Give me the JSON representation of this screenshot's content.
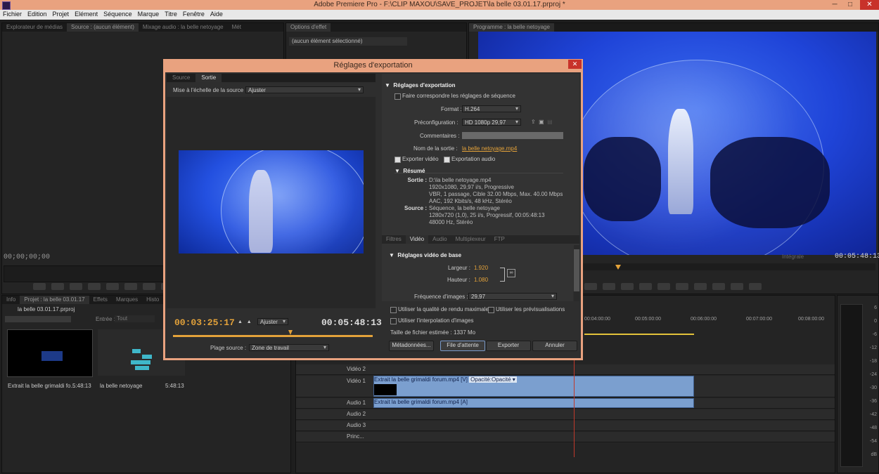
{
  "window": {
    "title": "Adobe Premiere Pro - F:\\CLIP MAXOU\\SAVE_PROJET\\la belle 03.01.17.prproj *",
    "minimize": "─",
    "maximize": "□",
    "close": "✕"
  },
  "menu": [
    "Fichier",
    "Edition",
    "Projet",
    "Elément",
    "Séquence",
    "Marque",
    "Titre",
    "Fenêtre",
    "Aide"
  ],
  "source_panel": {
    "tabs": [
      "Explorateur de médias",
      "Source : (aucun élément)",
      "Mixage audio : la belle netoyage",
      "Mét"
    ],
    "timecode": "00;00;00;00"
  },
  "effects_panel": {
    "tab": "Options d'effet",
    "placeholder": "(aucun élément sélectionné)"
  },
  "program_panel": {
    "tab": "Programme : la belle netoyage",
    "zoom": "Intégrale",
    "timecode": "00:05:48:13"
  },
  "project_panel": {
    "tabs": [
      "Info",
      "Projet : la belle 03.01.17",
      "Effets",
      "Marques",
      "Histo"
    ],
    "project_name": "la belle 03.01.17.prproj",
    "entry_label": "Entrée :",
    "entry_value": "Tout",
    "items": [
      {
        "name": "Extrait la belle grimaldi fo...",
        "duration": "5:48:13"
      },
      {
        "name": "la belle netoyage",
        "duration": "5:48:13"
      }
    ]
  },
  "timeline": {
    "ruler": [
      "00:04:00:00",
      "00:05:00:00",
      "00:06:00:00",
      "00:07:00:00",
      "00:08:00:00"
    ],
    "tracks": [
      {
        "name": "Vidéo 2"
      },
      {
        "name": "Vidéo 1",
        "clip": "Extrait la belle grimaldi forum.mp4 [V]",
        "fx": "Opacité:Opacité ▾"
      },
      {
        "name": "Audio 1",
        "clip": "Extrait la belle grimaldi forum.mp4 [A]"
      },
      {
        "name": "Audio 2"
      },
      {
        "name": "Audio 3"
      },
      {
        "name": "Princ..."
      }
    ]
  },
  "meter": {
    "labels": [
      "6",
      "0",
      "-6",
      "-12",
      "-18",
      "-24",
      "-30",
      "-36",
      "-42",
      "-48",
      "-54",
      "dB"
    ]
  },
  "dialog": {
    "title": "Réglages d'exportation",
    "close": "✕",
    "left_tabs": [
      "Source",
      "Sortie"
    ],
    "scale_label": "Mise à l'échelle de la source :",
    "scale_value": "Ajuster",
    "current_tc": "00:03:25:17",
    "fit_value": "Ajuster",
    "end_tc": "00:05:48:13",
    "range_label": "Plage source :",
    "range_value": "Zone de travail",
    "section_title": "Réglages d'exportation",
    "match_seq": "Faire correspondre les réglages de séquence",
    "format_label": "Format :",
    "format_value": "H.264",
    "preset_label": "Préconfiguration :",
    "preset_value": "HD 1080p 29,97",
    "comments_label": "Commentaires :",
    "output_label": "Nom de la sortie :",
    "output_value": "la belle netoyage.mp4",
    "export_video": "Exporter vidéo",
    "export_audio": "Exportation audio",
    "summary_title": "Résumé",
    "summary_output_label": "Sortie :",
    "summary_output": [
      "D:\\la belle netoyage.mp4",
      "1920x1080, 29,97 i/s, Progressive",
      "VBR, 1 passage, Cible 32.00 Mbps, Max. 40.00 Mbps",
      "AAC, 192  Kbits/s, 48  kHz, Stéréo"
    ],
    "summary_source_label": "Source :",
    "summary_source": [
      "Séquence, la belle netoyage",
      "1280x720 (1,0), 25  i/s, Progressif, 00:05:48:13",
      "48000 Hz, Stéréo"
    ],
    "right_tabs": [
      "Filtres",
      "Vidéo",
      "Audio",
      "Multiplexeur",
      "FTP"
    ],
    "basic_video": "Réglages vidéo de base",
    "width_label": "Largeur :",
    "width_value": "1.920",
    "height_label": "Hauteur :",
    "height_value": "1.080",
    "fps_label": "Fréquence d'images :",
    "fps_value": "29,97",
    "max_quality": "Utiliser la qualité de rendu maximale",
    "previews": "Utiliser les prévisualisations",
    "interp": "Utiliser l'interpolation d'images",
    "filesize_label": "Taille de fichier estimée :",
    "filesize_value": "1337 Mo",
    "buttons": {
      "metadata": "Métadonnées...",
      "queue": "File d'attente",
      "export": "Exporter",
      "cancel": "Annuler"
    }
  },
  "colors": {
    "accent": "#e3a23a",
    "dialog_frame": "#e9a27f",
    "clip": "#7b9fcf",
    "close": "#c8322a"
  }
}
